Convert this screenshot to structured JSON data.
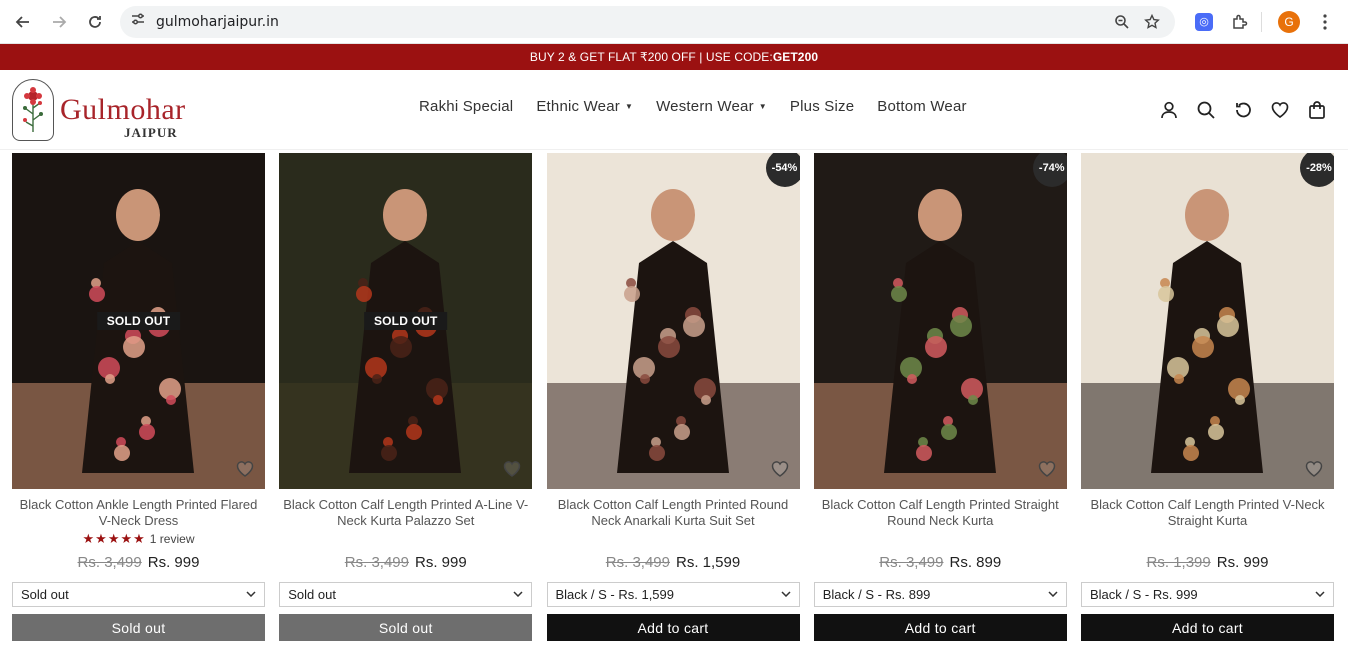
{
  "browser": {
    "url": "gulmoharjaipur.in",
    "profile_initial": "G"
  },
  "announcement": {
    "text": "BUY 2 & GET FLAT ₹200 OFF | USE CODE: ",
    "code": "GET200"
  },
  "brand": {
    "name": "Gulmohar",
    "city": "JAIPUR"
  },
  "menu": [
    {
      "label": "Rakhi Special",
      "has_dropdown": false
    },
    {
      "label": "Ethnic Wear",
      "has_dropdown": true
    },
    {
      "label": "Western Wear",
      "has_dropdown": true
    },
    {
      "label": "Plus Size",
      "has_dropdown": false
    },
    {
      "label": "Bottom Wear",
      "has_dropdown": false
    }
  ],
  "header_icons": [
    "account-icon",
    "search-icon",
    "recent-icon",
    "wishlist-icon",
    "cart-icon"
  ],
  "products": [
    {
      "title": "Black Cotton Ankle Length Printed Flared V-Neck Dress",
      "badge": "SOLD OUT",
      "discount": "",
      "rating_stars": "★★★★★",
      "reviews": "1 review",
      "compare_price": "Rs. 3,499",
      "price": "Rs. 999",
      "variant": "Sold out",
      "button": "Sold out",
      "available": false,
      "palette": [
        "#1a1411",
        "#c98d6e",
        "#e2a18a",
        "#d14b5b"
      ]
    },
    {
      "title": "Black Cotton Calf Length Printed A-Line V-Neck Kurta Palazzo Set",
      "badge": "SOLD OUT",
      "discount": "",
      "rating_stars": "",
      "reviews": "",
      "compare_price": "Rs. 3,499",
      "price": "Rs. 999",
      "variant": "Sold out",
      "button": "Sold out",
      "available": false,
      "palette": [
        "#2a2b1c",
        "#3e3a22",
        "#4a2217",
        "#b3361b"
      ]
    },
    {
      "title": "Black Cotton Calf Length Printed Round Neck Anarkali Kurta Suit Set",
      "badge": "",
      "discount": "-54%",
      "rating_stars": "",
      "reviews": "",
      "compare_price": "Rs. 3,499",
      "price": "Rs. 1,599",
      "variant": "Black / S - Rs. 1,599",
      "button": "Add to cart",
      "available": true,
      "palette": [
        "#ece4d8",
        "#3b2723",
        "#8a4a3e",
        "#c9a08c"
      ]
    },
    {
      "title": "Black Cotton Calf Length Printed Straight Round Neck Kurta",
      "badge": "",
      "discount": "-74%",
      "rating_stars": "",
      "reviews": "",
      "compare_price": "Rs. 3,499",
      "price": "Rs. 899",
      "variant": "Black / S - Rs. 899",
      "button": "Add to cart",
      "available": true,
      "palette": [
        "#201a16",
        "#c48a6c",
        "#d25a5f",
        "#6f8a4a"
      ]
    },
    {
      "title": "Black Cotton Calf Length Printed V-Neck Straight Kurta",
      "badge": "",
      "discount": "-28%",
      "rating_stars": "",
      "reviews": "",
      "compare_price": "Rs. 1,399",
      "price": "Rs. 999",
      "variant": "Black / S - Rs. 999",
      "button": "Add to cart",
      "available": true,
      "palette": [
        "#e9e1d4",
        "#2a211c",
        "#c7864f",
        "#d8c59b"
      ]
    }
  ]
}
